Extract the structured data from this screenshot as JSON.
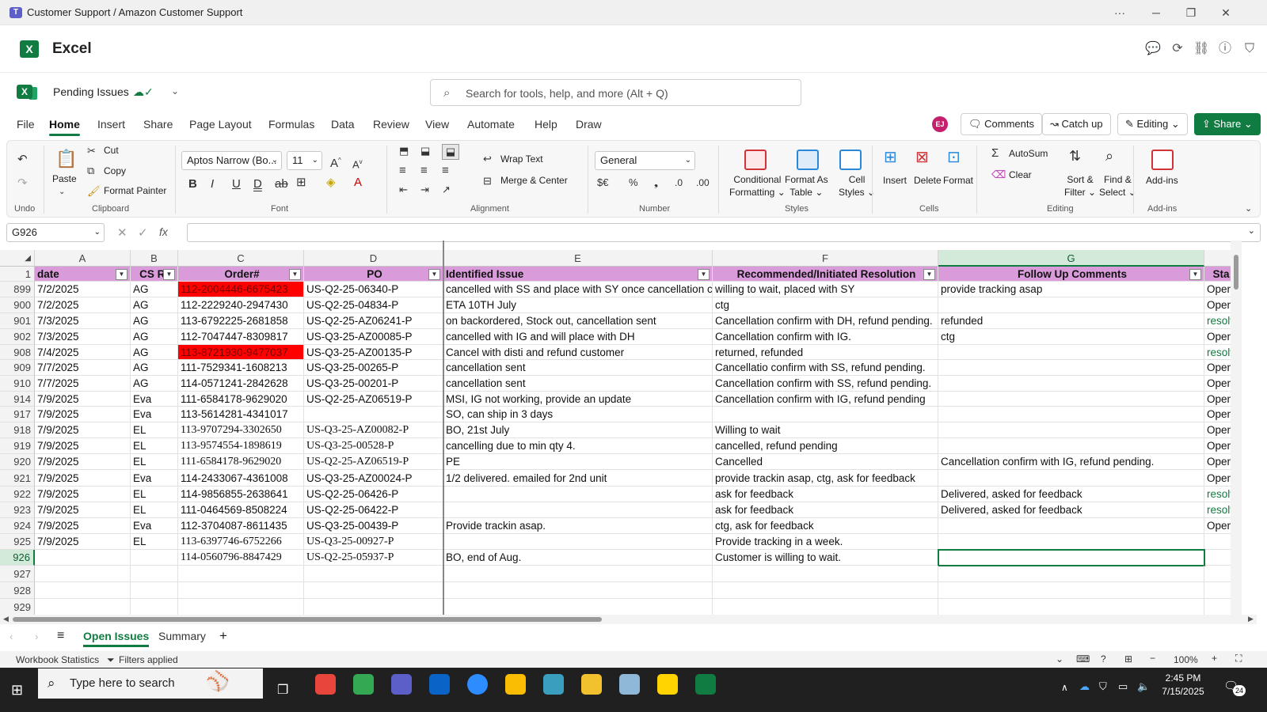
{
  "window": {
    "title": "Customer Support / Amazon Customer Support"
  },
  "app": {
    "name": "Excel"
  },
  "doc": {
    "name": "Pending Issues"
  },
  "search": {
    "placeholder": "Search for tools, help, and more (Alt + Q)"
  },
  "menu_tabs": [
    "File",
    "Home",
    "Insert",
    "Share",
    "Page Layout",
    "Formulas",
    "Data",
    "Review",
    "View",
    "Automate",
    "Help",
    "Draw"
  ],
  "avatar": "EJ",
  "top_buttons": {
    "comments": "Comments",
    "catchup": "Catch up",
    "editing": "Editing",
    "share": "Share"
  },
  "ribbon": {
    "undo_group": "Undo",
    "paste": "Paste",
    "cut": "Cut",
    "copy": "Copy",
    "format_painter": "Format Painter",
    "clipboard_group": "Clipboard",
    "font_name": "Aptos Narrow (Bo...",
    "font_size": "11",
    "font_group": "Font",
    "wrap_text": "Wrap Text",
    "merge_center": "Merge & Center",
    "alignment_group": "Alignment",
    "number_format": "General",
    "number_group": "Number",
    "conditional_formatting": [
      "Conditional",
      "Formatting"
    ],
    "format_as_table": [
      "Format As",
      "Table"
    ],
    "cell_styles": [
      "Cell",
      "Styles"
    ],
    "styles_group": "Styles",
    "insert": "Insert",
    "delete": "Delete",
    "format": "Format",
    "cells_group": "Cells",
    "autosum": "AutoSum",
    "clear": "Clear",
    "sort_filter": [
      "Sort &",
      "Filter"
    ],
    "find_select": [
      "Find &",
      "Select"
    ],
    "editing_group": "Editing",
    "addins": "Add-ins",
    "addins_group": "Add-ins"
  },
  "formula_bar": {
    "name_box": "G926",
    "formula": ""
  },
  "columns": [
    "A",
    "B",
    "C",
    "D",
    "E",
    "F",
    "G"
  ],
  "header_row": {
    "row": "1",
    "cells": [
      "date",
      "CS Re",
      "Order#",
      "PO",
      "Identified Issue",
      "Recommended/Initiated Resolution",
      "Follow Up Comments",
      "Sta"
    ]
  },
  "rows": [
    {
      "n": "899",
      "cells": [
        "7/2/2025",
        "AG",
        "112-2004446-6675423",
        "US-Q2-25-06340-P",
        "cancelled with SS and place with SY once cancellation conf",
        "willing to wait, placed with SY",
        "provide tracking asap",
        "Open"
      ],
      "red": true
    },
    {
      "n": "900",
      "cells": [
        "7/2/2025",
        "AG",
        "112-2229240-2947430",
        "US-Q2-25-04834-P",
        "ETA 10TH July",
        "ctg",
        "",
        "Open"
      ]
    },
    {
      "n": "901",
      "cells": [
        "7/3/2025",
        "AG",
        "113-6792225-2681858",
        "US-Q2-25-AZ06241-P",
        "on backordered, Stock out, cancellation sent",
        "Cancellation confirm with DH, refund pending.",
        "refunded",
        "resolv"
      ]
    },
    {
      "n": "902",
      "cells": [
        "7/3/2025",
        "AG",
        "112-7047447-8309817",
        "US-Q3-25-AZ00085-P",
        "cancelled with IG and will place with DH",
        "Cancellation confirm with IG.",
        "ctg",
        "Open"
      ]
    },
    {
      "n": "908",
      "cells": [
        "7/4/2025",
        "AG",
        "113-8721930-9477037",
        "US-Q3-25-AZ00135-P",
        "Cancel with disti and refund customer",
        "returned, refunded",
        "",
        "resolv"
      ],
      "red": true
    },
    {
      "n": "909",
      "cells": [
        "7/7/2025",
        "AG",
        "111-7529341-1608213",
        "US-Q3-25-00265-P",
        "cancellation sent",
        "Cancellatio confirm with SS, refund pending.",
        "",
        "Open"
      ]
    },
    {
      "n": "910",
      "cells": [
        "7/7/2025",
        "AG",
        "114-0571241-2842628",
        "US-Q3-25-00201-P",
        "cancellation sent",
        "Cancellation confirm with SS, refund pending.",
        "",
        "Open"
      ]
    },
    {
      "n": "914",
      "cells": [
        "7/9/2025",
        "Eva",
        "111-6584178-9629020",
        "US-Q2-25-AZ06519-P",
        "MSI, IG not working, provide an update",
        "Cancellation confirm with IG, refund pending",
        "",
        "Open"
      ]
    },
    {
      "n": "917",
      "cells": [
        "7/9/2025",
        "Eva",
        "113-5614281-4341017",
        "",
        "SO, can ship in 3 days",
        "",
        "",
        "Open"
      ]
    },
    {
      "n": "918",
      "cells": [
        "7/9/2025",
        "EL",
        "113-9707294-3302650",
        "US-Q3-25-AZ00082-P",
        "BO, 21st July",
        "Willing to wait",
        "",
        "Open"
      ],
      "serif": true
    },
    {
      "n": "919",
      "cells": [
        "7/9/2025",
        "EL",
        "113-9574554-1898619",
        "US-Q3-25-00528-P",
        "cancelling due to min qty 4.",
        "cancelled, refund pending",
        "",
        "Open"
      ],
      "serif": true
    },
    {
      "n": "920",
      "cells": [
        "7/9/2025",
        "EL",
        "111-6584178-9629020",
        "US-Q2-25-AZ06519-P",
        "PE",
        "Cancelled",
        "Cancellation confirm with IG, refund pending.",
        "Open"
      ],
      "serif": true
    },
    {
      "n": "921",
      "cells": [
        "7/9/2025",
        "Eva",
        "114-2433067-4361008",
        "US-Q3-25-AZ00024-P",
        "1/2 delivered. emailed for 2nd unit",
        "provide trackin asap, ctg, ask for feedback",
        "",
        "Open"
      ]
    },
    {
      "n": "922",
      "cells": [
        "7/9/2025",
        "EL",
        "114-9856855-2638641",
        "US-Q2-25-06426-P",
        "",
        "ask for feedback",
        "Delivered, asked for feedback",
        "resolv"
      ]
    },
    {
      "n": "923",
      "cells": [
        "7/9/2025",
        "EL",
        "111-0464569-8508224",
        "US-Q2-25-06422-P",
        "",
        "ask for feedback",
        "Delivered, asked for feedback",
        "resolv"
      ]
    },
    {
      "n": "924",
      "cells": [
        "7/9/2025",
        "Eva",
        "112-3704087-8611435",
        "US-Q3-25-00439-P",
        "Provide trackin asap.",
        "ctg, ask for feedback",
        "",
        "Open"
      ]
    },
    {
      "n": "925",
      "cells": [
        "7/9/2025",
        "EL",
        "113-6397746-6752266",
        "US-Q3-25-00927-P",
        "",
        "Provide tracking in a week.",
        "",
        ""
      ],
      "serif": true
    },
    {
      "n": "926",
      "cells": [
        "",
        "",
        "114-0560796-8847429",
        "US-Q2-25-05937-P",
        "BO, end of Aug.",
        "Customer is willing to wait.",
        "",
        ""
      ],
      "serif": true
    },
    {
      "n": "927",
      "cells": [
        "",
        "",
        "",
        "",
        "",
        "",
        "",
        ""
      ]
    },
    {
      "n": "928",
      "cells": [
        "",
        "",
        "",
        "",
        "",
        "",
        "",
        ""
      ]
    },
    {
      "n": "929",
      "cells": [
        "",
        "",
        "",
        "",
        "",
        "",
        "",
        ""
      ]
    }
  ],
  "sheet_tabs": [
    "Open Issues",
    "Summary"
  ],
  "status": {
    "stats": "Workbook Statistics",
    "filters": "Filters applied",
    "zoom": "100%"
  },
  "taskbar": {
    "search": "Type here to search",
    "time": "2:45 PM",
    "date": "7/15/2025",
    "notif": "24"
  }
}
